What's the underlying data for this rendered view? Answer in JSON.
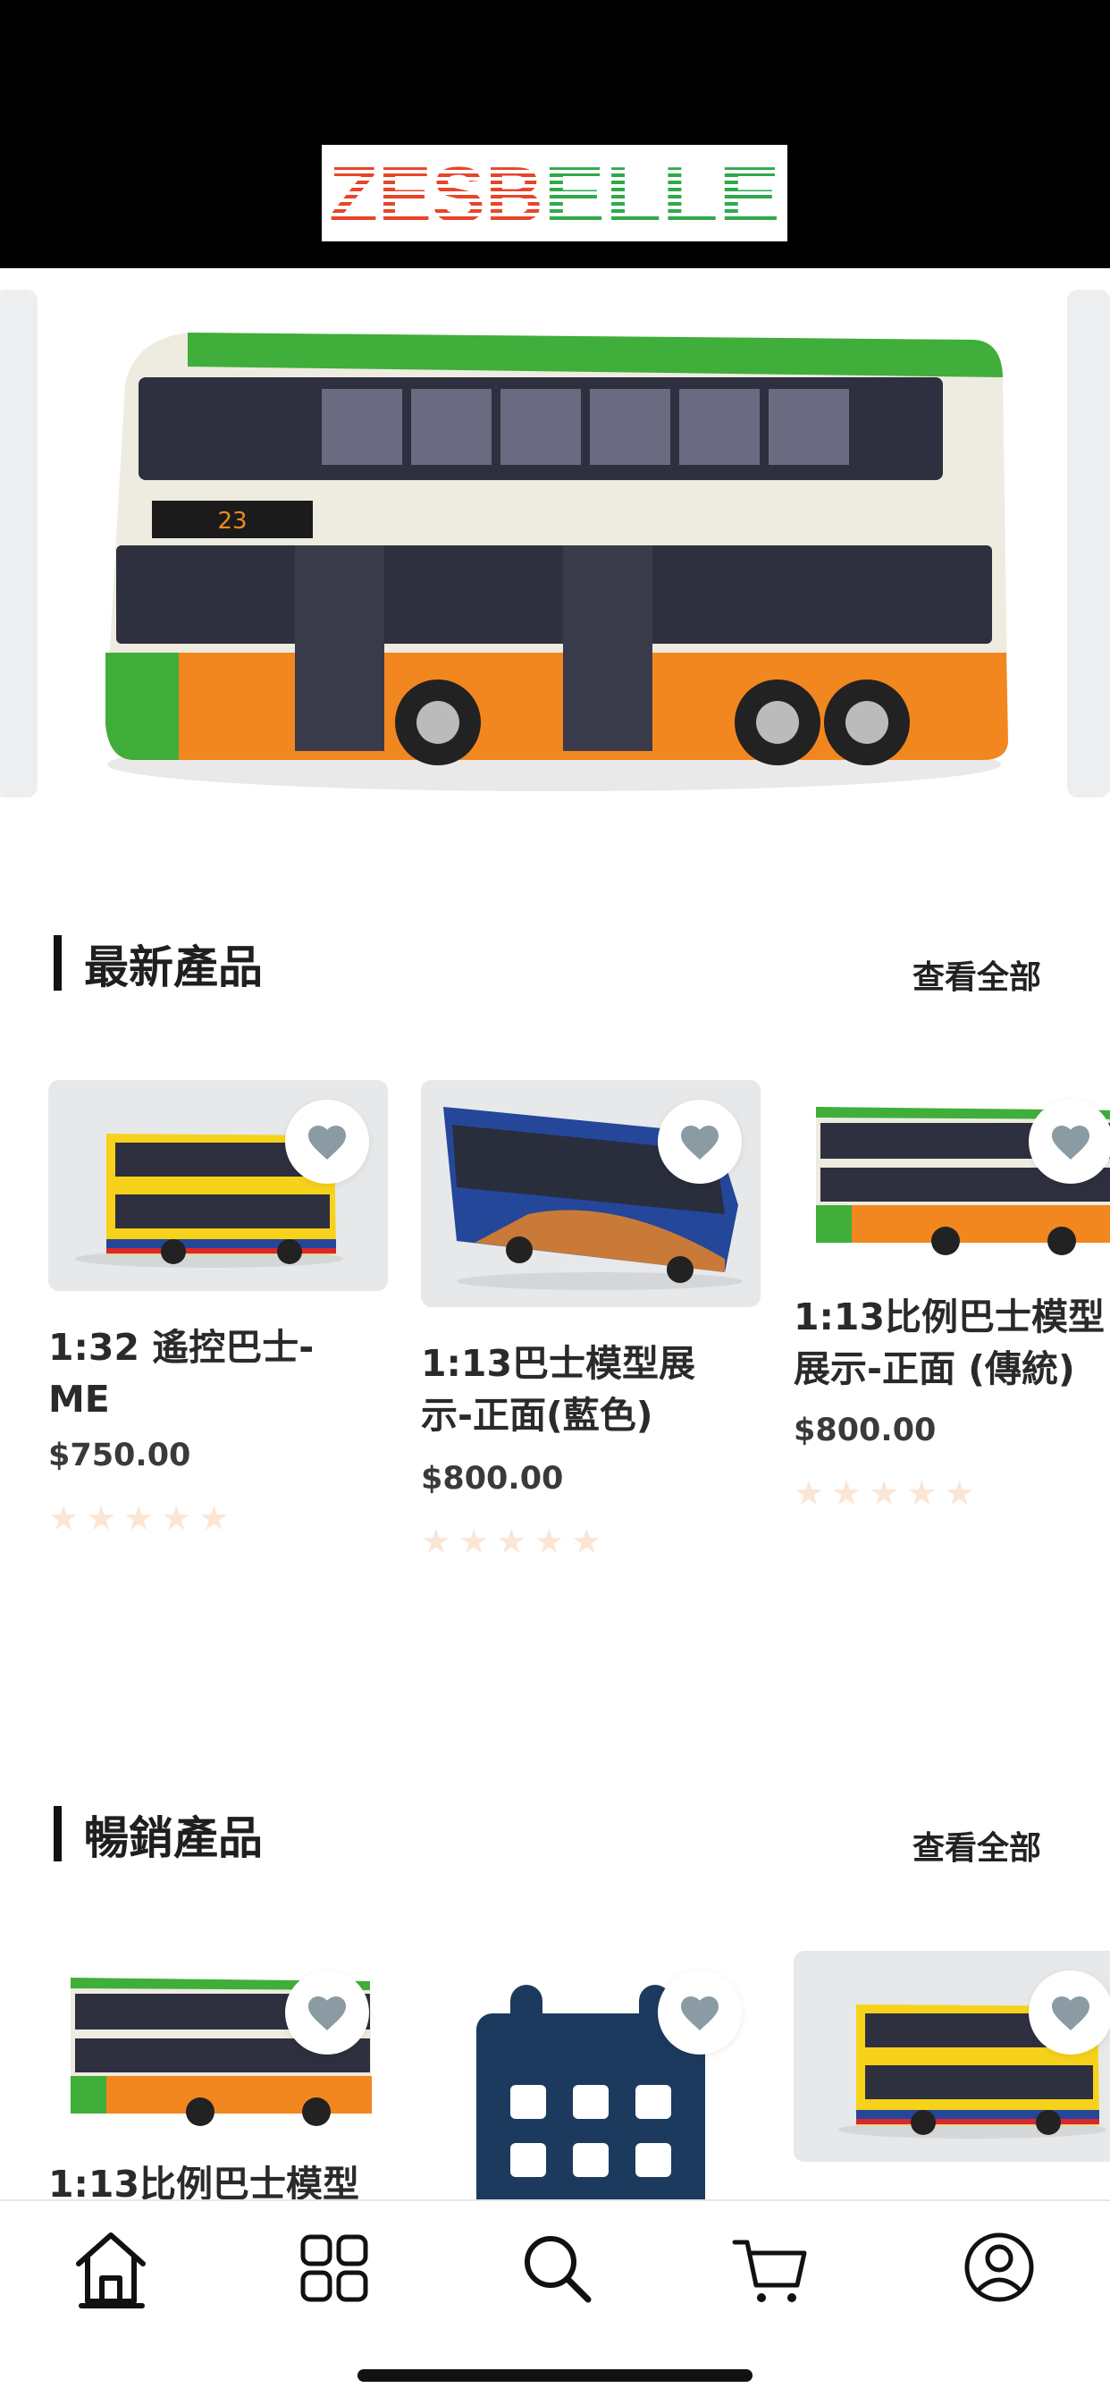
{
  "header": {
    "logo_text": "ZESBELLE"
  },
  "sections": {
    "newest": {
      "title": "最新產品",
      "see_all": "查看全部",
      "products": [
        {
          "name": "1:32 遙控巴士-\nME",
          "price": "$750.00",
          "rating": 0
        },
        {
          "name": "1:13巴士模型展\n示-正面(藍色)",
          "price": "$800.00",
          "rating": 0
        },
        {
          "name": "1:13比例巴士模型\n展示-正面 (傳統)",
          "price": "$800.00",
          "rating": 0
        }
      ]
    },
    "bestselling": {
      "title": "暢銷產品",
      "see_all": "查看全部",
      "products": [
        {
          "name": "1:13比例巴士模型"
        },
        {
          "name": ""
        },
        {
          "name": ""
        }
      ]
    }
  },
  "tabbar": {
    "items": [
      "home-icon",
      "categories-icon",
      "search-icon",
      "cart-icon",
      "profile-icon"
    ]
  },
  "colors": {
    "logo_red": "#e8442a",
    "logo_green": "#2eaa4a",
    "heart_gray": "#8a9ba4",
    "star_empty": "#fbe6d6",
    "bus_green": "#3fae3a",
    "bus_orange": "#f3871f",
    "bus_yellow": "#f7d21a",
    "bus_blue": "#24479a",
    "calendar_navy": "#1c3a5e"
  }
}
